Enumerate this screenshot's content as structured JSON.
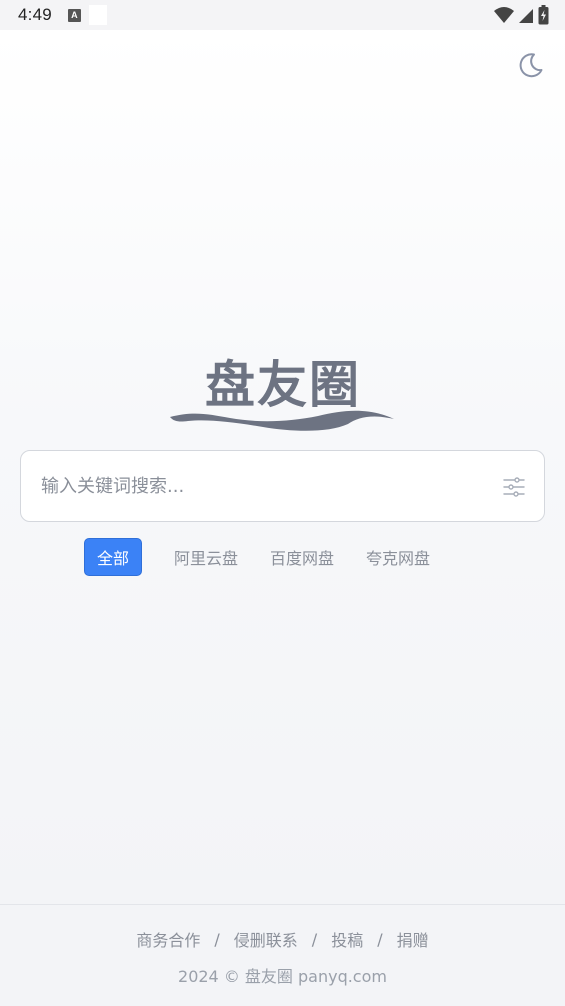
{
  "status_bar": {
    "time": "4:49",
    "notification_icon": "A"
  },
  "header": {
    "theme_icon": "moon-icon"
  },
  "logo": {
    "text": "盘友圈"
  },
  "search": {
    "placeholder": "输入关键词搜索...",
    "value": "",
    "filter_icon": "sliders-icon"
  },
  "tabs": [
    {
      "label": "全部",
      "active": true
    },
    {
      "label": "阿里云盘",
      "active": false
    },
    {
      "label": "百度网盘",
      "active": false
    },
    {
      "label": "夸克网盘",
      "active": false
    }
  ],
  "footer": {
    "links": [
      "商务合作",
      "侵删联系",
      "投稿",
      "捐赠"
    ],
    "separator": "/",
    "copyright": "2024 © 盘友圈 panyq.com"
  },
  "colors": {
    "accent": "#3b82f6",
    "text_muted": "#8b909a",
    "logo": "#6d7382"
  }
}
